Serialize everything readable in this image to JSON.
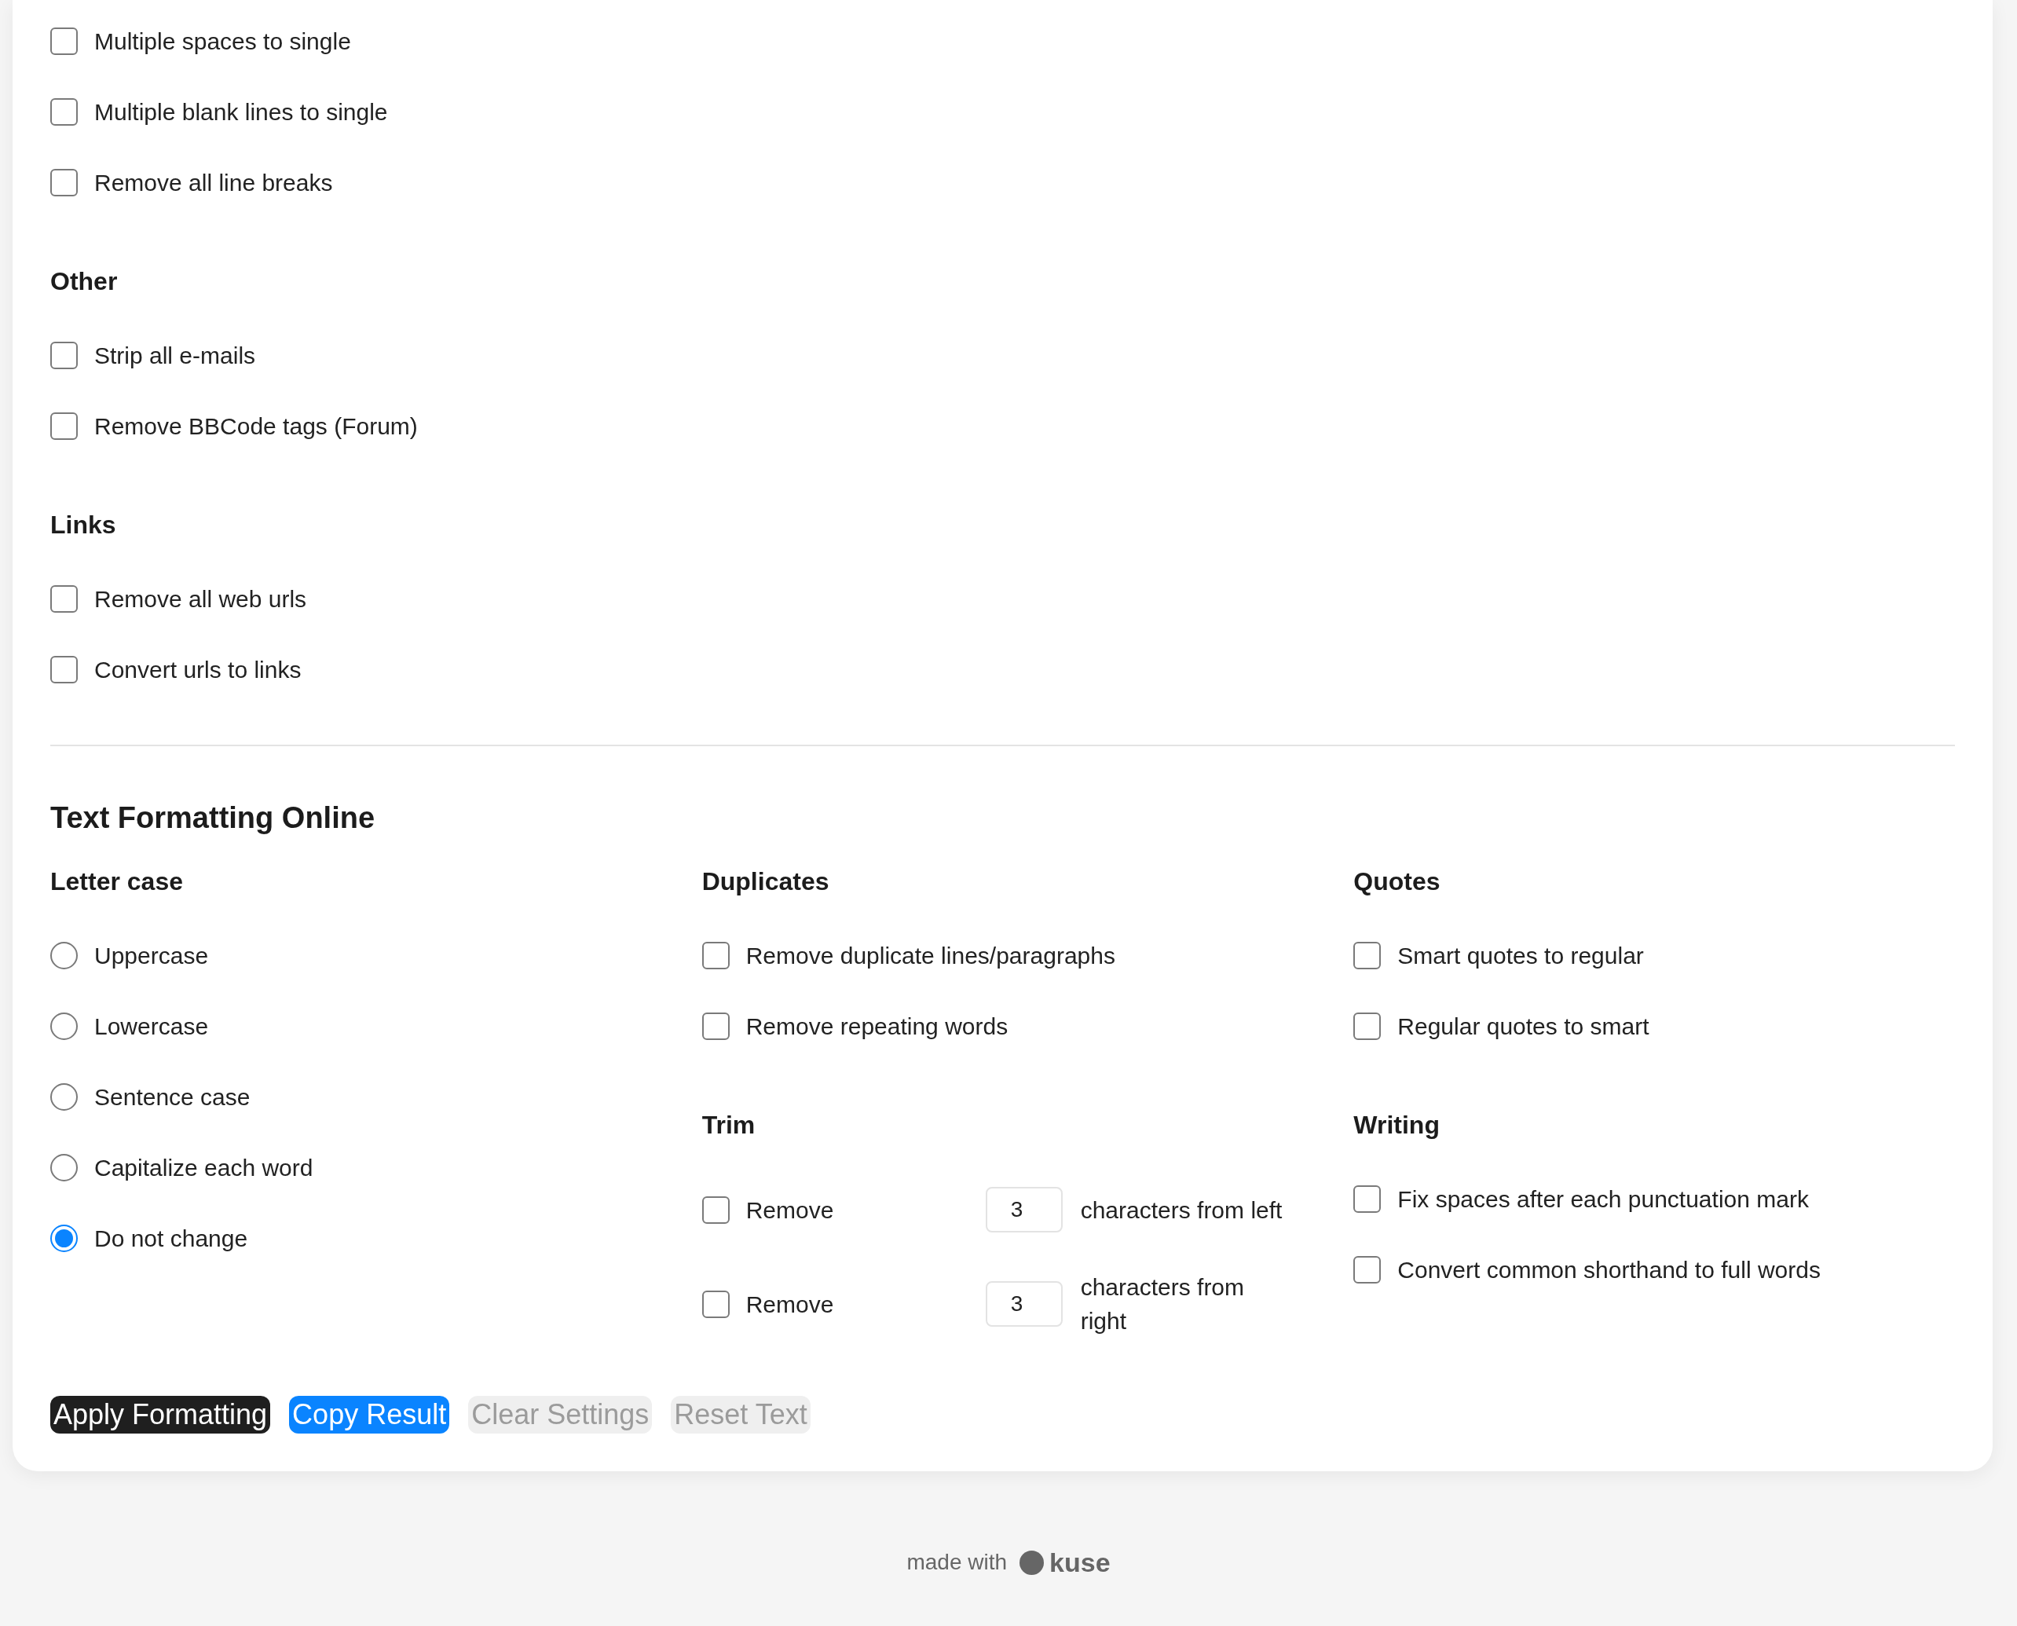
{
  "sections": [
    {
      "options": [
        {
          "label": "Multiple spaces to single",
          "checked": false
        },
        {
          "label": "Multiple blank lines to single",
          "checked": false
        },
        {
          "label": "Remove all line breaks",
          "checked": false
        }
      ]
    },
    {
      "heading": "Other",
      "options": [
        {
          "label": "Strip all e-mails",
          "checked": false
        },
        {
          "label": "Remove BBCode tags (Forum)",
          "checked": false
        }
      ]
    },
    {
      "heading": "Links",
      "options": [
        {
          "label": "Remove all web urls",
          "checked": false
        },
        {
          "label": "Convert urls to links",
          "checked": false
        }
      ]
    }
  ],
  "formatting": {
    "title": "Text Formatting Online",
    "letter_case": {
      "heading": "Letter case",
      "options": [
        {
          "label": "Uppercase",
          "selected": false
        },
        {
          "label": "Lowercase",
          "selected": false
        },
        {
          "label": "Sentence case",
          "selected": false
        },
        {
          "label": "Capitalize each word",
          "selected": false
        },
        {
          "label": "Do not change",
          "selected": true
        }
      ]
    },
    "duplicates": {
      "heading": "Duplicates",
      "options": [
        {
          "label": "Remove duplicate lines/paragraphs",
          "checked": false
        },
        {
          "label": "Remove repeating words",
          "checked": false
        }
      ]
    },
    "trim": {
      "heading": "Trim",
      "rows": [
        {
          "label": "Remove",
          "checked": false,
          "value": "3",
          "suffix": "characters from left"
        },
        {
          "label": "Remove",
          "checked": false,
          "value": "3",
          "suffix": "characters from right"
        }
      ]
    },
    "quotes": {
      "heading": "Quotes",
      "options": [
        {
          "label": "Smart quotes to regular",
          "checked": false
        },
        {
          "label": "Regular quotes to smart",
          "checked": false
        }
      ]
    },
    "writing": {
      "heading": "Writing",
      "options": [
        {
          "label": "Fix spaces after each punctuation mark",
          "checked": false
        },
        {
          "label": "Convert common shorthand to full words",
          "checked": false
        }
      ]
    }
  },
  "buttons": [
    {
      "label": "Apply Formatting",
      "kind": "primary",
      "disabled": false
    },
    {
      "label": "Copy Result",
      "kind": "accent",
      "disabled": false
    },
    {
      "label": "Clear Settings",
      "kind": "secondary",
      "disabled": true
    },
    {
      "label": "Reset Text",
      "kind": "secondary",
      "disabled": true
    }
  ],
  "footer": {
    "text": "made with",
    "brand": "kuse"
  }
}
